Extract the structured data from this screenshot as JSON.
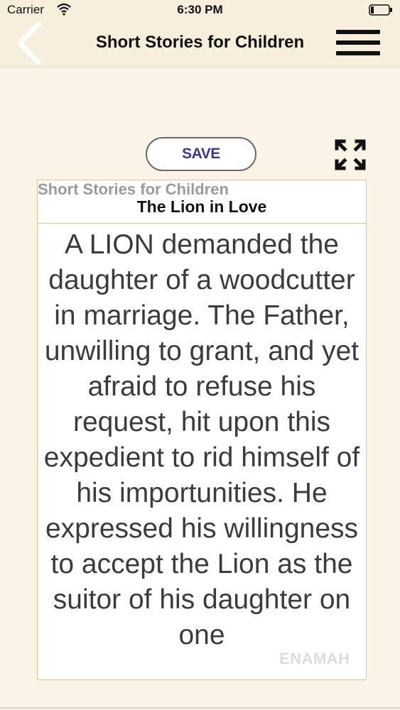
{
  "status_bar": {
    "carrier": "Carrier",
    "time": "6:30 PM"
  },
  "nav": {
    "title": "Short Stories for Children",
    "back_icon": "chevron-left-icon",
    "menu_icon": "hamburger-menu-icon"
  },
  "toolbar": {
    "save_label": "SAVE",
    "fullscreen_icon": "expand-arrows-icon"
  },
  "story": {
    "app_name": "Short Stories for Children",
    "title": "The Lion in Love",
    "body": "A LION demanded the daughter of a woodcutter in marriage. The Father, unwilling to grant, and yet afraid to refuse his request, hit upon this expedient to rid himself of his importunities. He expressed his willingness to accept the Lion as the suitor of his daughter on one"
  },
  "watermark": "ENAMAH",
  "colors": {
    "background": "#fbf3e5",
    "navbar": "#f7eedc",
    "save_text": "#3f3493",
    "card_border": "#e2c58a",
    "body_text": "#3b3b3b"
  }
}
